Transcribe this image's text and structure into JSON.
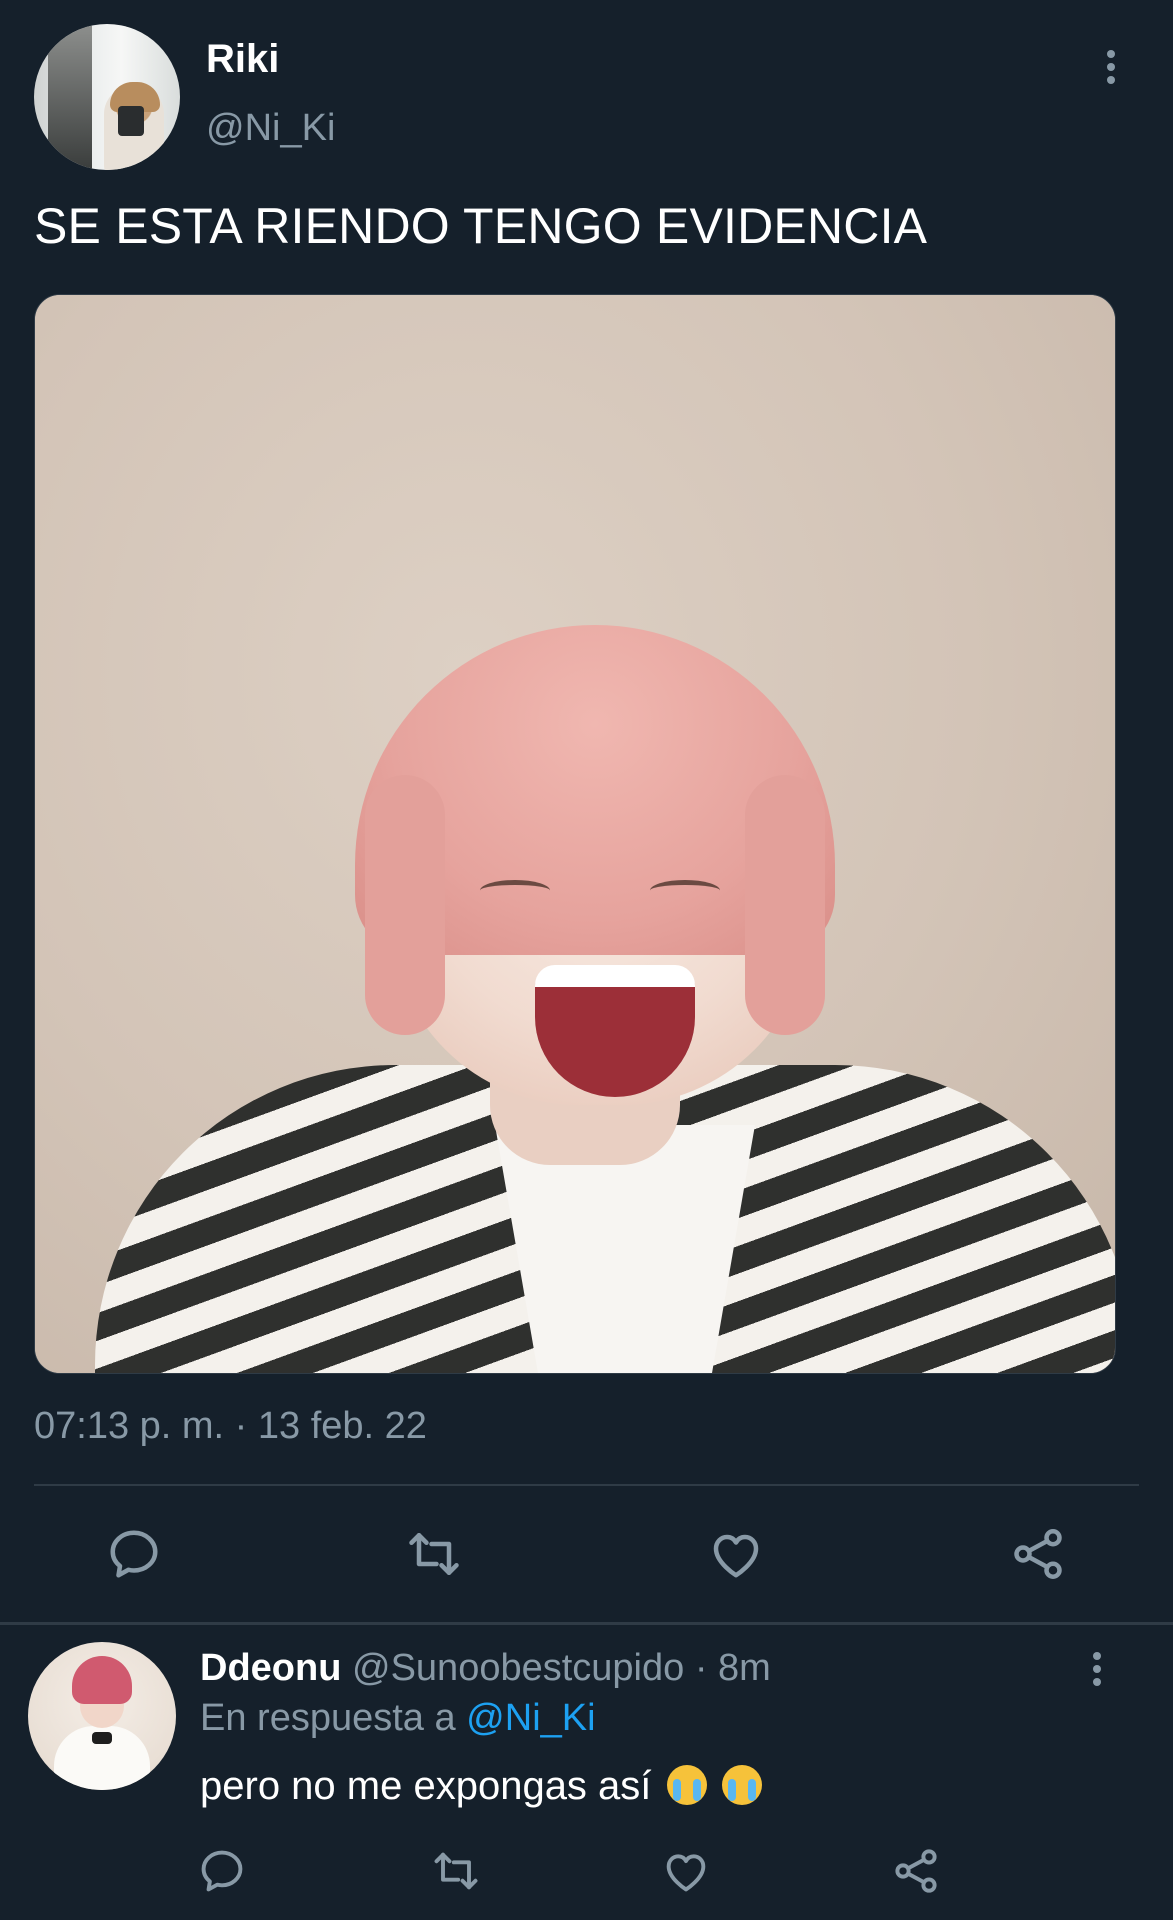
{
  "tweet": {
    "author_name": "Riki",
    "author_handle": "@Ni_Ki",
    "text": "SE ESTA RIENDO TENGO EVIDENCIA",
    "timestamp": "07:13 p. m. · 13 feb. 22",
    "icons": [
      "more-vertical-icon",
      "reply-icon",
      "retweet-icon",
      "like-icon",
      "share-icon"
    ]
  },
  "reply": {
    "author_name": "Ddeonu",
    "author_handle": "@Sunoobestcupido",
    "time": "· 8m",
    "in_reply_prefix": "En respuesta a",
    "in_reply_handle": "@Ni_Ki",
    "text": "pero no me expongas así",
    "emojis": [
      "loudly-crying-face",
      "loudly-crying-face"
    ],
    "icons": [
      "more-vertical-icon",
      "reply-icon",
      "retweet-icon",
      "like-icon",
      "share-icon"
    ]
  },
  "colors": {
    "background": "#15202b",
    "secondary_text": "#8899a6",
    "mention": "#1da1f2",
    "divider": "#2f3b46"
  }
}
